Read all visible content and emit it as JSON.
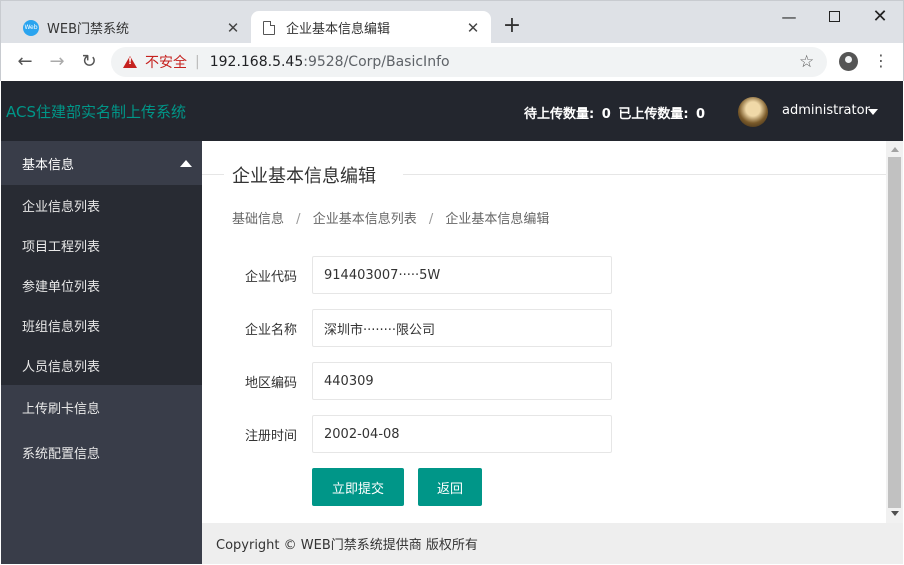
{
  "browser": {
    "tabs": [
      {
        "title": "WEB门禁系统",
        "favicon": "Web"
      },
      {
        "title": "企业基本信息编辑"
      }
    ],
    "tab_close": "✕",
    "new_tab": "+",
    "security_label": "不安全",
    "url_host": "192.168.5.45",
    "url_rest": ":9528/Corp/BasicInfo",
    "icons": [
      "back-arrow-icon",
      "forward-arrow-icon",
      "reload-icon",
      "warning-icon",
      "star-icon",
      "profile-icon",
      "menu-icon"
    ]
  },
  "header": {
    "brand": "ACS住建部实名制上传系统",
    "pending_label": "待上传数量:",
    "pending_count": "0",
    "uploaded_label": "已上传数量:",
    "uploaded_count": "0",
    "username": "administrator"
  },
  "sidebar": {
    "group_label": "基本信息",
    "subitems": [
      "企业信息列表",
      "项目工程列表",
      "参建单位列表",
      "班组信息列表",
      "人员信息列表"
    ],
    "items": [
      "上传刷卡信息",
      "系统配置信息"
    ]
  },
  "main": {
    "legend": "企业基本信息编辑",
    "breadcrumb": [
      "基础信息",
      "企业基本信息列表",
      "企业基本信息编辑"
    ],
    "breadcrumb_sep": "/",
    "fields": [
      {
        "label": "企业代码",
        "value": "914403007·····5W"
      },
      {
        "label": "企业名称",
        "value": "深圳市········限公司"
      },
      {
        "label": "地区编码",
        "value": "440309"
      },
      {
        "label": "注册时间",
        "value": "2002-04-08"
      }
    ],
    "submit_label": "立即提交",
    "back_label": "返回"
  },
  "footer": {
    "copyright": "Copyright © WEB门禁系统提供商 版权所有"
  },
  "colors": {
    "header_bg": "#23262e",
    "sidebar_bg": "#393d49",
    "sidebar_sub_bg": "#282b33",
    "accent": "#009688",
    "insecure": "#c5221f"
  }
}
